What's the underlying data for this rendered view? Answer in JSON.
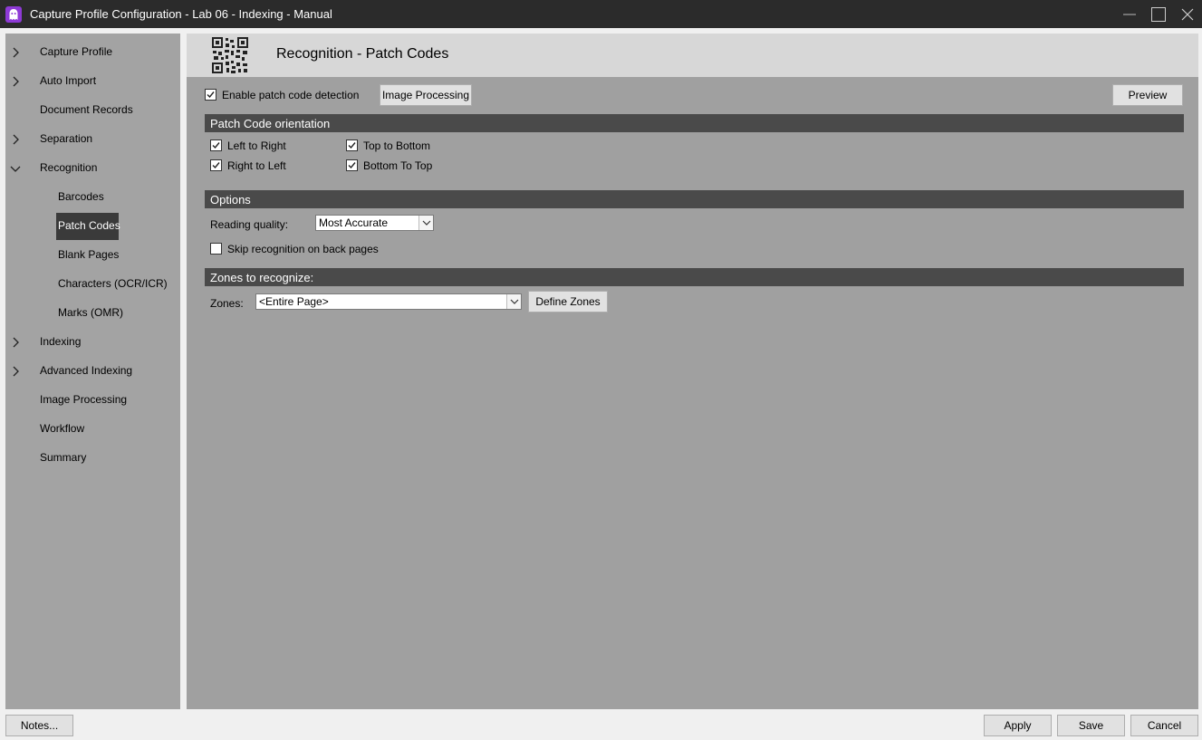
{
  "window": {
    "title": "Capture Profile Configuration - Lab 06 - Indexing - Manual",
    "app_icon": "ghost-logo-icon"
  },
  "sidebar": {
    "items": [
      {
        "label": "Capture Profile",
        "chevron": "right"
      },
      {
        "label": "Auto Import",
        "chevron": "right"
      },
      {
        "label": "Document Records",
        "chevron": "none"
      },
      {
        "label": "Separation",
        "chevron": "right"
      },
      {
        "label": "Recognition",
        "chevron": "down"
      },
      {
        "label": "Barcodes",
        "sub": true
      },
      {
        "label": "Patch Codes",
        "sub": true,
        "selected": true
      },
      {
        "label": "Blank Pages",
        "sub": true
      },
      {
        "label": "Characters (OCR/ICR)",
        "sub": true
      },
      {
        "label": "Marks (OMR)",
        "sub": true
      },
      {
        "label": "Indexing",
        "chevron": "right"
      },
      {
        "label": "Advanced Indexing",
        "chevron": "right"
      },
      {
        "label": "Image Processing",
        "chevron": "none"
      },
      {
        "label": "Workflow",
        "chevron": "none"
      },
      {
        "label": "Summary",
        "chevron": "none"
      }
    ]
  },
  "header": {
    "title": "Recognition - Patch Codes",
    "icon": "qr-code-icon"
  },
  "top_row": {
    "enable_label": "Enable patch code detection",
    "enable_checked": true,
    "image_processing_label": "Image Processing",
    "preview_label": "Preview"
  },
  "orientation": {
    "section_title": "Patch Code orientation",
    "left_to_right": {
      "label": "Left to Right",
      "checked": true
    },
    "right_to_left": {
      "label": "Right to Left",
      "checked": true
    },
    "top_to_bottom": {
      "label": "Top to Bottom",
      "checked": true
    },
    "bottom_to_top": {
      "label": "Bottom To Top",
      "checked": true
    }
  },
  "options": {
    "section_title": "Options",
    "reading_quality_label": "Reading quality:",
    "reading_quality_value": "Most Accurate",
    "skip_back_label": "Skip recognition on back pages",
    "skip_back_checked": false
  },
  "zones": {
    "section_title": "Zones to recognize:",
    "zones_label": "Zones:",
    "zones_value": "<Entire Page>",
    "define_zones_label": "Define Zones"
  },
  "footer": {
    "notes_label": "Notes...",
    "apply_label": "Apply",
    "save_label": "Save",
    "cancel_label": "Cancel"
  },
  "colors": {
    "titlebar": "#2b2b2b",
    "sidebar": "#a3a3a3",
    "content_body": "#a0a0a0",
    "section_bar": "#4a4a4a",
    "selected": "#3a3a3a",
    "accent": "#8e3ad6"
  }
}
